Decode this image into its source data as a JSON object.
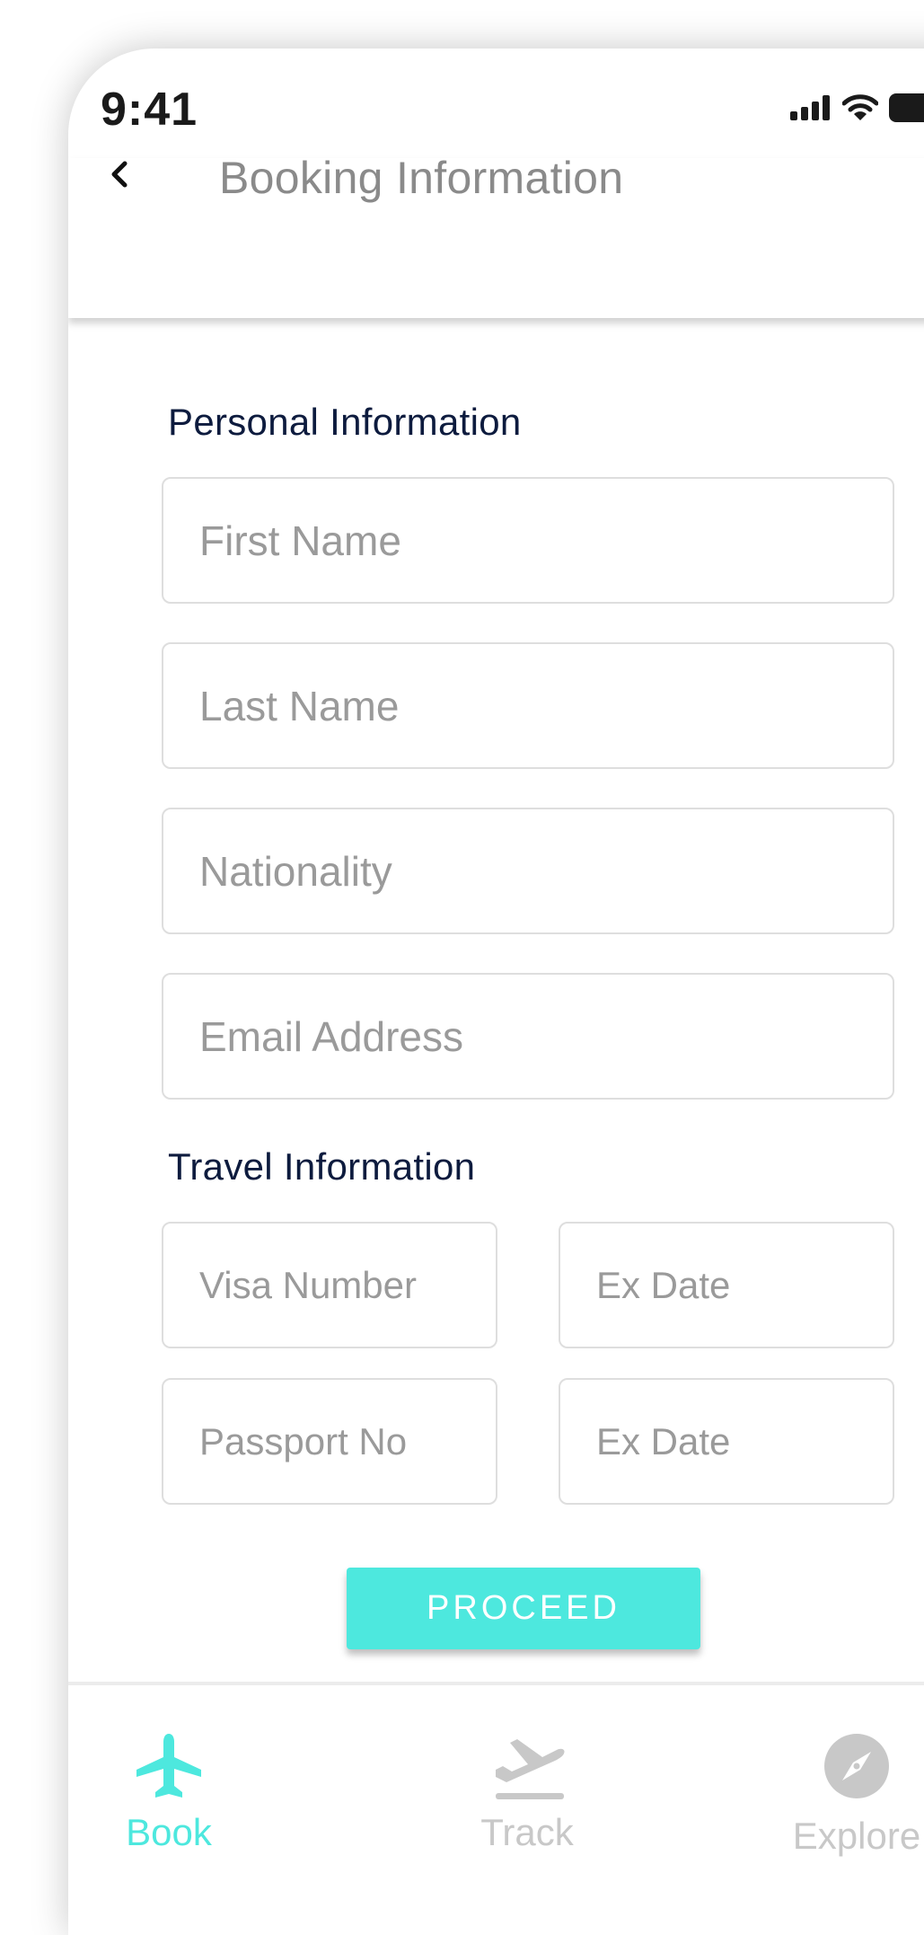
{
  "status_bar": {
    "time": "9:41"
  },
  "header": {
    "title": "Booking Information",
    "back_icon": "chevron-left-icon"
  },
  "personal_section": {
    "title": "Personal Information",
    "fields": {
      "first_name": {
        "placeholder": "First Name",
        "value": ""
      },
      "last_name": {
        "placeholder": "Last Name",
        "value": ""
      },
      "nationality": {
        "placeholder": "Nationality",
        "value": ""
      },
      "email": {
        "placeholder": "Email Address",
        "value": ""
      }
    }
  },
  "travel_section": {
    "title": "Travel Information",
    "fields": {
      "visa_number": {
        "placeholder": "Visa Number",
        "value": ""
      },
      "visa_ex_date": {
        "placeholder": "Ex Date",
        "value": ""
      },
      "passport_no": {
        "placeholder": "Passport No",
        "value": ""
      },
      "passport_ex_date": {
        "placeholder": "Ex Date",
        "value": ""
      }
    }
  },
  "proceed_button": {
    "label": "PROCEED"
  },
  "tab_bar": {
    "tabs": [
      {
        "label": "Book",
        "icon": "airplane-icon",
        "active": true
      },
      {
        "label": "Track",
        "icon": "flight-departure-icon",
        "active": false
      },
      {
        "label": "Explore",
        "icon": "compass-icon",
        "active": false
      }
    ]
  },
  "colors": {
    "accent": "#4DE8DE",
    "section_title": "#0D1B3E",
    "placeholder": "#9A9A9A",
    "header_title": "#8A8A8A",
    "inactive_tab": "#C8C8C8",
    "field_border": "#DEDEDE"
  }
}
